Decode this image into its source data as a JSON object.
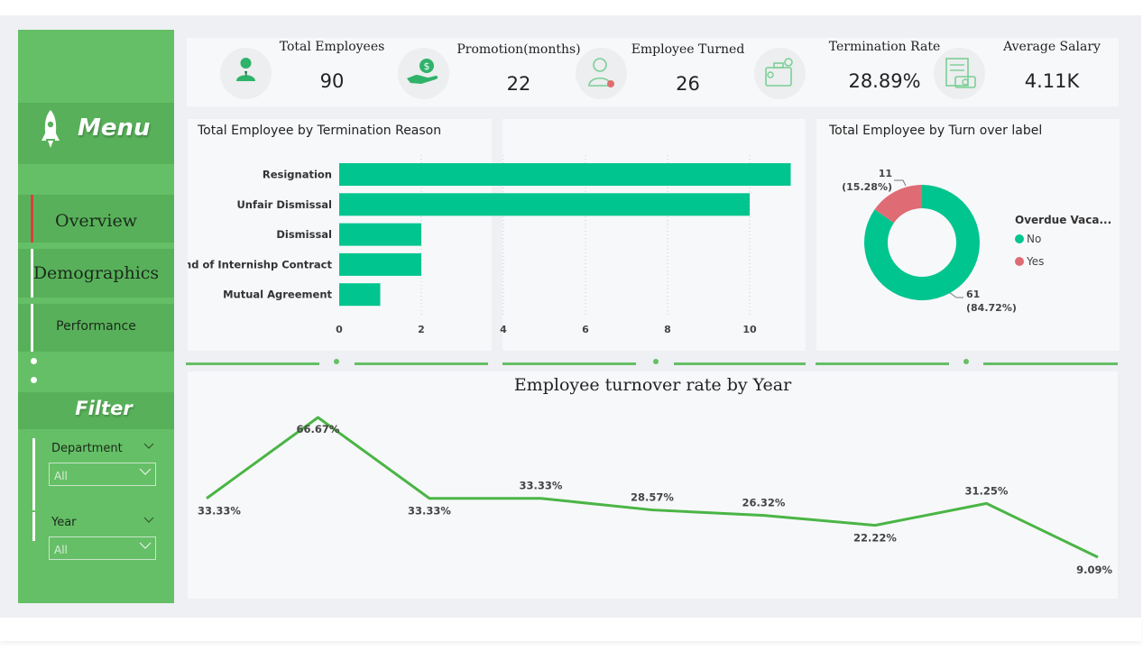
{
  "menu": {
    "title": "Menu",
    "items": [
      {
        "label": "Overview"
      },
      {
        "label": "Demographics"
      },
      {
        "label": "Performance"
      }
    ]
  },
  "filter": {
    "title": "Filter",
    "department": {
      "label": "Department",
      "value": "All"
    },
    "year": {
      "label": "Year",
      "value": "All"
    }
  },
  "kpis": [
    {
      "label": "Total Employees",
      "value": "90",
      "icon": "person-icon"
    },
    {
      "label": "Promotion(months)",
      "value": "22",
      "icon": "money-hand-icon"
    },
    {
      "label": "Employee Turned",
      "value": "26",
      "icon": "employee-badge-icon"
    },
    {
      "label": "Termination Rate",
      "value": "28.89%",
      "icon": "briefcase-people-icon"
    },
    {
      "label": "Average Salary",
      "value": "4.11K",
      "icon": "salary-money-icon"
    }
  ],
  "colors": {
    "sidebar": "#65bf66",
    "sidebar_band": "#58b15a",
    "bar": "#00c58e",
    "donut_no": "#00c58e",
    "donut_yes": "#df6b74",
    "line": "#4ab545",
    "active_indicator": "#d93f3f"
  },
  "chart_data": [
    {
      "type": "bar",
      "orientation": "horizontal",
      "title": "Total Employee by Termination Reason",
      "categories": [
        "Resignation",
        "Unfair Dismissal",
        "Dismissal",
        "End of Internishp Contract",
        "Mutual Agreement"
      ],
      "values": [
        11,
        10,
        2,
        2,
        1
      ],
      "xticks": [
        "0",
        "2",
        "4",
        "6",
        "8",
        "10"
      ],
      "xlim": [
        0,
        11.2
      ],
      "grid": true
    },
    {
      "type": "pie",
      "donut": true,
      "title": "Total Employee by Turn over label",
      "legend_title": "Overdue Vaca...",
      "legend_position": "right",
      "slices": [
        {
          "name": "No",
          "value": 61,
          "label_count": "61",
          "label_pct": "(84.72%)"
        },
        {
          "name": "Yes",
          "value": 11,
          "label_count": "11",
          "label_pct": "(15.28%)"
        }
      ]
    },
    {
      "type": "line",
      "title": "Employee turnover rate by Year",
      "values": [
        33.33,
        66.67,
        33.33,
        33.33,
        28.57,
        26.32,
        22.22,
        31.25,
        9.09
      ],
      "labels": [
        "33.33%",
        "66.67%",
        "33.33%",
        "33.33%",
        "28.57%",
        "26.32%",
        "22.22%",
        "31.25%",
        "9.09%"
      ],
      "ylim": [
        0,
        70
      ]
    }
  ]
}
